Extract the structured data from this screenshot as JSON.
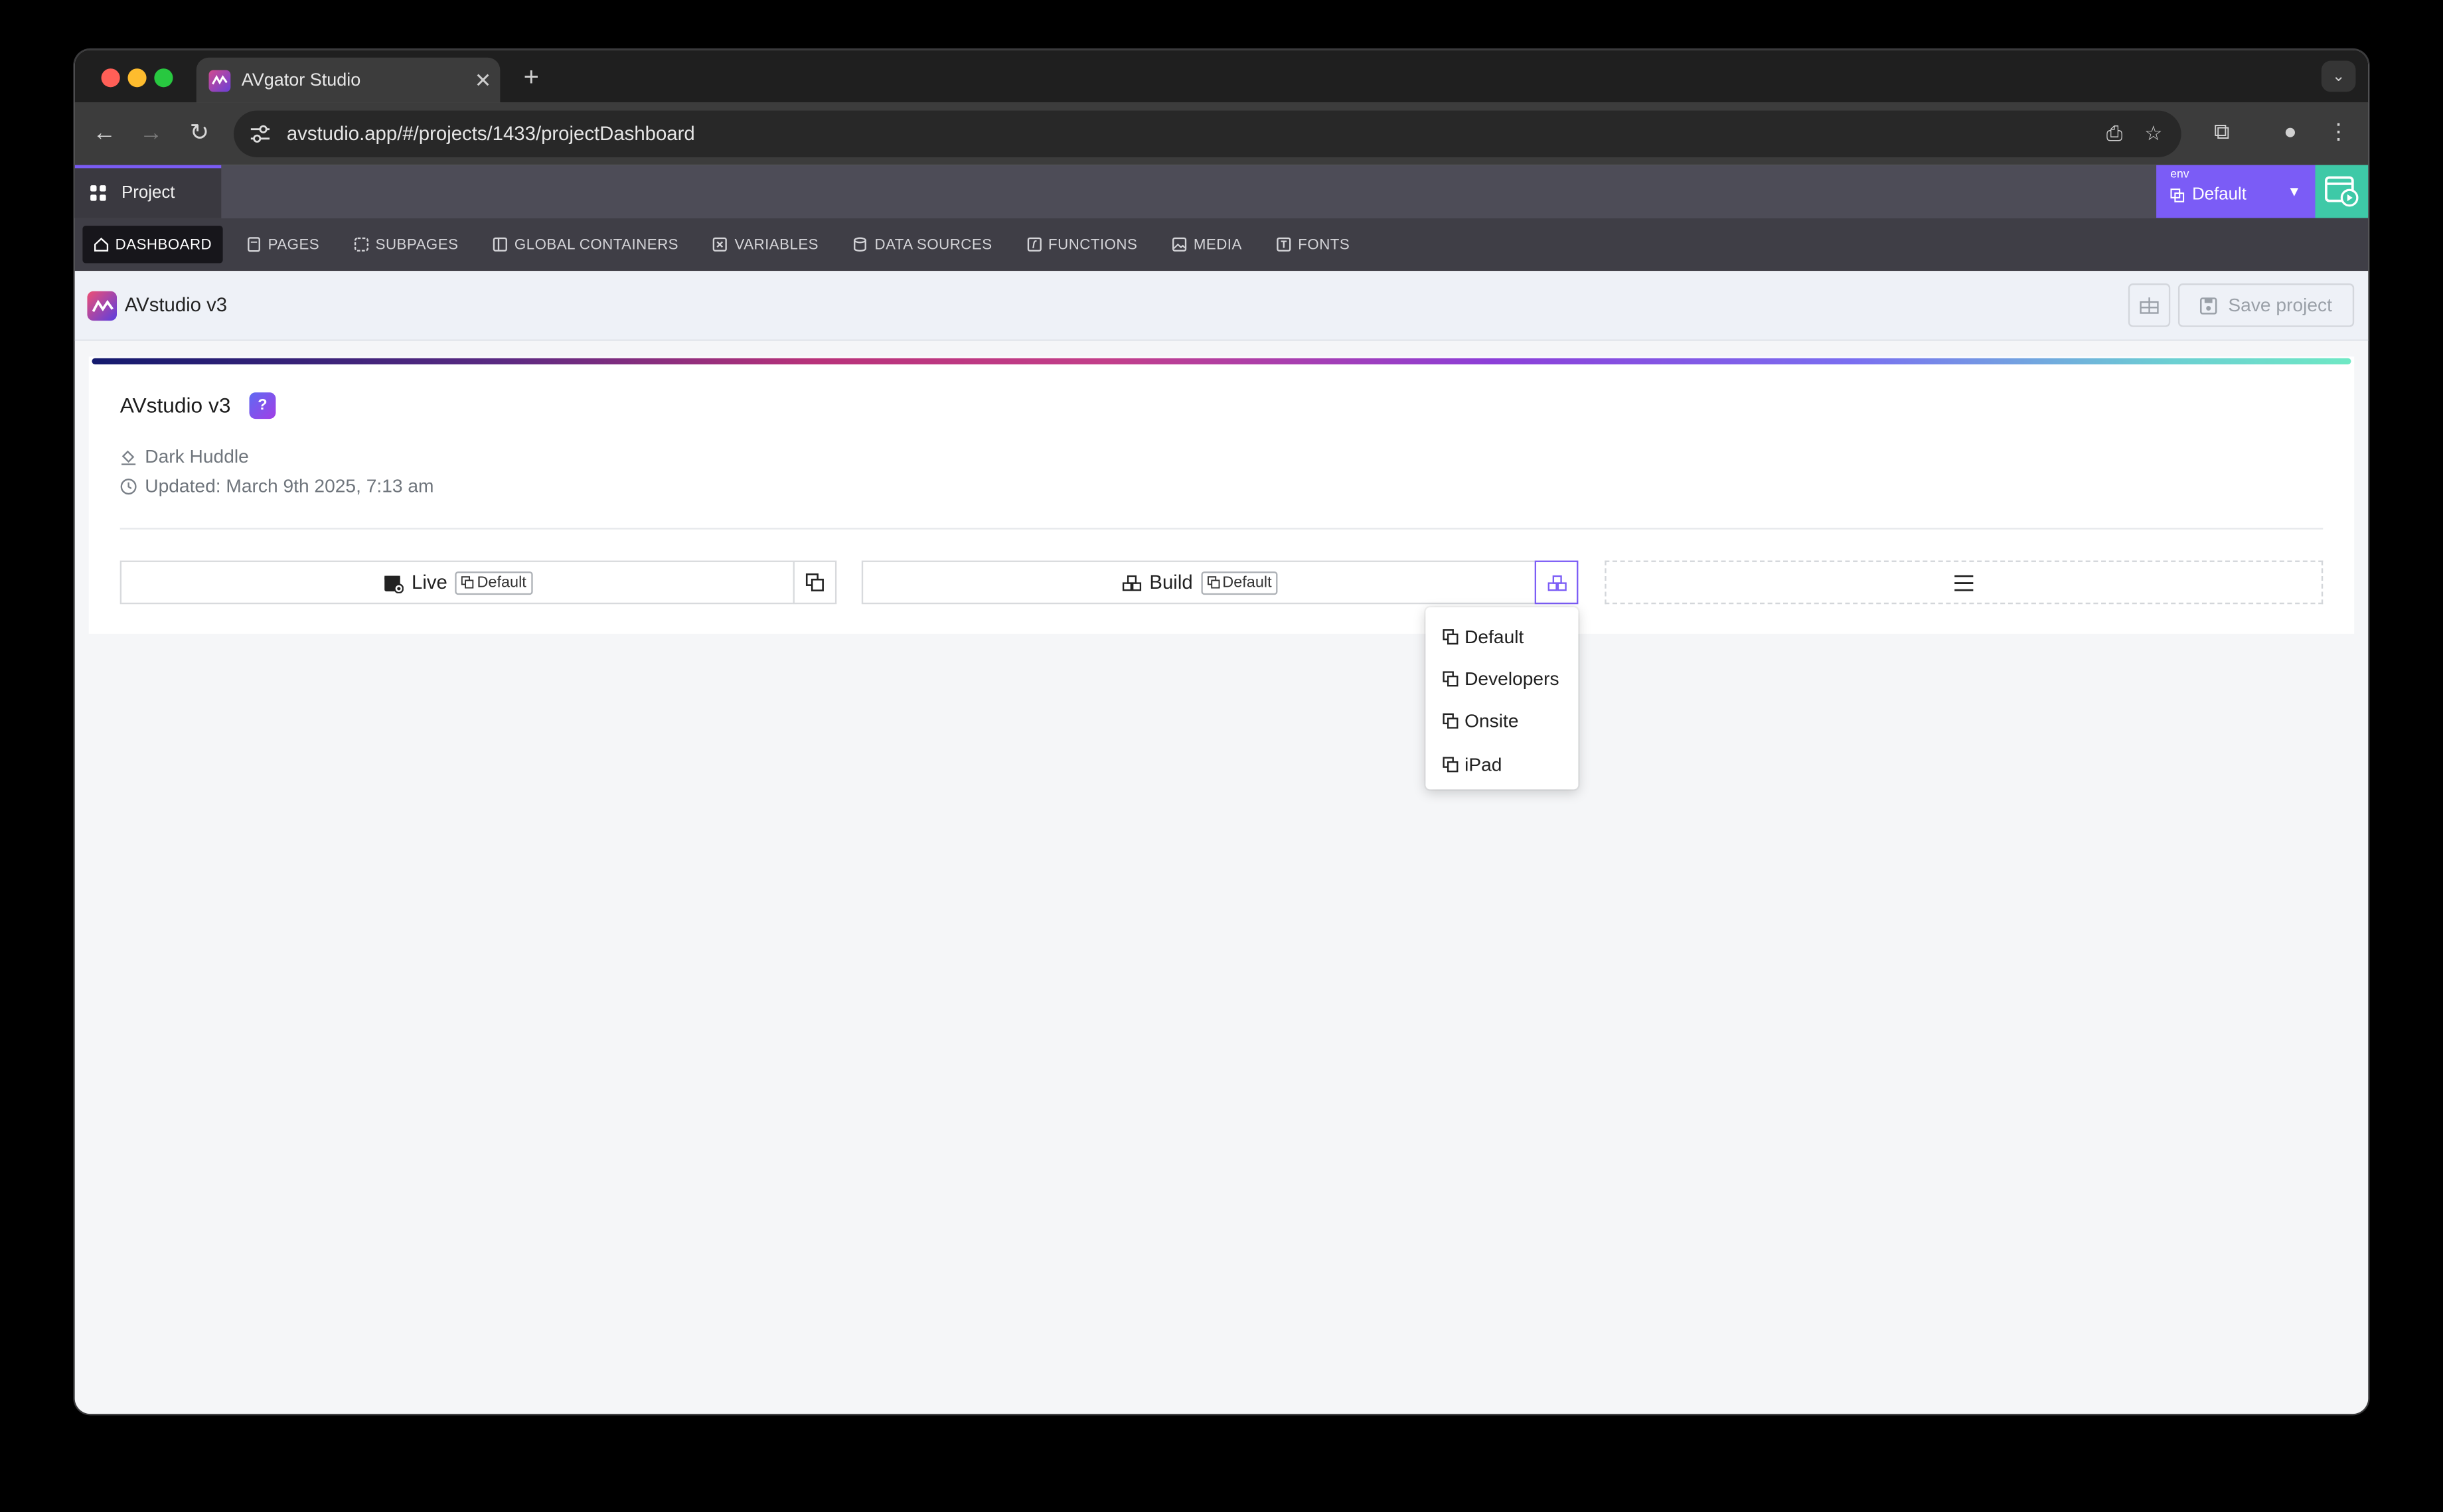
{
  "browser": {
    "tab_title": "AVgator Studio",
    "new_tab": "+",
    "url": "avstudio.app/#/projects/1433/projectDashboard"
  },
  "app": {
    "project_tab": "Project",
    "env_label": "env",
    "env_value": "Default",
    "accent": "#7b5cf6",
    "run_color": "#3ec9a7"
  },
  "nav": {
    "items": [
      {
        "label": "DASHBOARD",
        "icon": "home-icon"
      },
      {
        "label": "PAGES",
        "icon": "page-icon"
      },
      {
        "label": "SUBPAGES",
        "icon": "subpage-icon"
      },
      {
        "label": "GLOBAL CONTAINERS",
        "icon": "container-icon"
      },
      {
        "label": "VARIABLES",
        "icon": "variable-icon"
      },
      {
        "label": "DATA SOURCES",
        "icon": "database-icon"
      },
      {
        "label": "FUNCTIONS",
        "icon": "function-icon"
      },
      {
        "label": "MEDIA",
        "icon": "image-icon"
      },
      {
        "label": "FONTS",
        "icon": "font-icon"
      }
    ]
  },
  "project_bar": {
    "name": "AVstudio v3",
    "save_label": "Save project"
  },
  "card": {
    "title": "AVstudio v3",
    "help": "?",
    "theme": "Dark Huddle",
    "updated": "Updated: March 9th 2025, 7:13 am",
    "live_label": "Live",
    "live_env": "Default",
    "build_label": "Build",
    "build_env": "Default"
  },
  "dropdown": {
    "options": [
      "Default",
      "Developers",
      "Onsite",
      "iPad"
    ]
  }
}
